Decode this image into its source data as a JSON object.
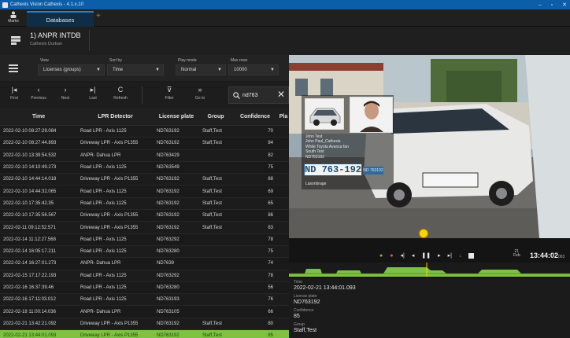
{
  "window": {
    "title": "Cathexis Vision Cathexis - 4.1.x.10",
    "controls": [
      "–",
      "▫",
      "✕"
    ]
  },
  "tabstrip": {
    "marks_label": "Marks",
    "active_tab": "Databases",
    "add_tab": "+"
  },
  "query": {
    "title": "1) ANPR INTDB",
    "subtitle": "Cathexis Durban"
  },
  "dropdowns": [
    {
      "label": "View",
      "value": "Licenses (groups)"
    },
    {
      "label": "Sort by",
      "value": "Time"
    },
    {
      "label": "Play mode",
      "value": "Normal"
    },
    {
      "label": "Max rows",
      "value": "10000"
    }
  ],
  "nav": [
    {
      "glyph": "|◂",
      "label": "First"
    },
    {
      "glyph": "‹",
      "label": "Previous"
    },
    {
      "glyph": "›",
      "label": "Next"
    },
    {
      "glyph": "▸|",
      "label": "Last"
    },
    {
      "glyph": "C",
      "label": "Refresh"
    },
    {
      "glyph": "⊽",
      "label": "Filter"
    },
    {
      "glyph": "»",
      "label": "Go to"
    }
  ],
  "search": {
    "value": "nd763",
    "clear": "✕"
  },
  "table": {
    "headers": [
      "Time",
      "LPR Detector",
      "License plate",
      "Group",
      "Confidence",
      "Pla"
    ],
    "rows": [
      {
        "time": "2022-02-10 08:27:29.084",
        "detector": "Road LPR - Axis 1125",
        "plate": "ND763192",
        "group": "Staff,Test",
        "conf": "70"
      },
      {
        "time": "2022-02-10 08:27:44.893",
        "detector": "Driveway LPR - Axis P1355",
        "plate": "ND763192",
        "group": "Staff,Test",
        "conf": "84"
      },
      {
        "time": "2022-02-10 13:39:54.532",
        "detector": "ANPR- Dahua LPR",
        "plate": "ND763429",
        "group": "",
        "conf": "82"
      },
      {
        "time": "2022-02-10 14:10:49.273",
        "detector": "Road LPR - Axis 1125",
        "plate": "ND763549",
        "group": "",
        "conf": "75"
      },
      {
        "time": "2022-02-10 14:44:14.018",
        "detector": "Driveway LPR - Axis P1355",
        "plate": "ND763192",
        "group": "Staff,Test",
        "conf": "88"
      },
      {
        "time": "2022-02-10 14:44:32.065",
        "detector": "Road LPR - Axis 1125",
        "plate": "ND763192",
        "group": "Staff,Test",
        "conf": "69"
      },
      {
        "time": "2022-02-10 17:35:42.35",
        "detector": "Road LPR - Axis 1125",
        "plate": "ND763192",
        "group": "Staff,Test",
        "conf": "65"
      },
      {
        "time": "2022-02-10 17:35:56.567",
        "detector": "Driveway LPR - Axis P1355",
        "plate": "ND763192",
        "group": "Staff,Test",
        "conf": "86"
      },
      {
        "time": "2022-02-11 09:12:52.571",
        "detector": "Driveway LPR - Axis P1355",
        "plate": "ND763192",
        "group": "Staff,Test",
        "conf": "83"
      },
      {
        "time": "2022-02-14 11:12:27.568",
        "detector": "Road LPR - Axis 1125",
        "plate": "ND763292",
        "group": "",
        "conf": "78"
      },
      {
        "time": "2022-02-14 16:05:17.211",
        "detector": "Road LPR - Axis 1125",
        "plate": "ND763280",
        "group": "",
        "conf": "75"
      },
      {
        "time": "2022-02-14 16:27:01.273",
        "detector": "ANPR- Dahua LPR",
        "plate": "ND7639",
        "group": "",
        "conf": "74"
      },
      {
        "time": "2022-02-15 17:17:22.193",
        "detector": "Road LPR - Axis 1125",
        "plate": "ND763292",
        "group": "",
        "conf": "78"
      },
      {
        "time": "2022-02-16 16:37:39.46",
        "detector": "Road LPR - Axis 1125",
        "plate": "ND763280",
        "group": "",
        "conf": "56"
      },
      {
        "time": "2022-02-16 17:11:03.012",
        "detector": "Road LPR - Axis 1125",
        "plate": "ND763193",
        "group": "",
        "conf": "76"
      },
      {
        "time": "2022-02-18 11:00:14.036",
        "detector": "ANPR- Dahua LPR",
        "plate": "ND763105",
        "group": "",
        "conf": "66"
      },
      {
        "time": "2022-02-21 13:42:21.092",
        "detector": "Driveway LPR - Axis P1355",
        "plate": "ND763192",
        "group": "Staff,Test",
        "conf": "80"
      },
      {
        "time": "2022-02-21 13:44:01.093",
        "detector": "Driveway LPR - Axis P1355",
        "plate": "ND763192",
        "group": "Staff,Test",
        "conf": "85",
        "selected": true
      }
    ]
  },
  "video": {
    "overlay_lines": [
      "John Test",
      "John Paul_Cathexis",
      "White Toyota Avanza fan",
      "South Test",
      "ND763192"
    ],
    "overlay_plate": "ND 763-192",
    "overlay_site": "Lasonbrage"
  },
  "playback": {
    "time": "13:44:02",
    "time_suffix": "083",
    "day": "21",
    "day_sub": "Feb"
  },
  "details": [
    {
      "label": "Time",
      "value": "2022-02-21 13:44:01.093"
    },
    {
      "label": "License plate",
      "value": "ND763192"
    },
    {
      "label": "Confidence",
      "value": "85"
    },
    {
      "label": "Group",
      "value": "Staff,Test"
    }
  ],
  "colors": {
    "accent_blue": "#0d5ea8",
    "selected_row": "#7dc242",
    "timeline_green": "#7dc242",
    "marker_yellow": "#ffd400"
  }
}
